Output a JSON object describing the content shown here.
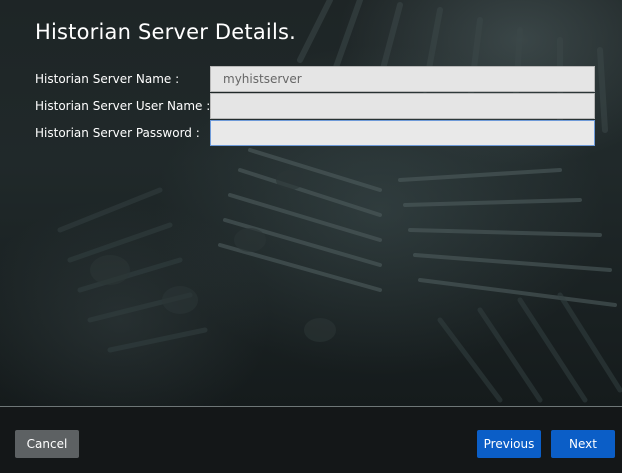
{
  "window": {
    "title": "Historian Server Details."
  },
  "form": {
    "server_name_label": "Historian Server Name :",
    "server_name_value": "myhistserver",
    "user_name_label": "Historian Server User Name :",
    "user_name_value": "",
    "password_label": "Historian Server Password :",
    "password_value": ""
  },
  "footer": {
    "cancel_label": "Cancel",
    "previous_label": "Previous",
    "next_label": "Next"
  },
  "colors": {
    "primary_button": "#0b5ec7",
    "secondary_button": "#5d6163",
    "background": "#15191a",
    "field_background": "#e5e5e5",
    "focus_border": "#6e9ad8"
  }
}
